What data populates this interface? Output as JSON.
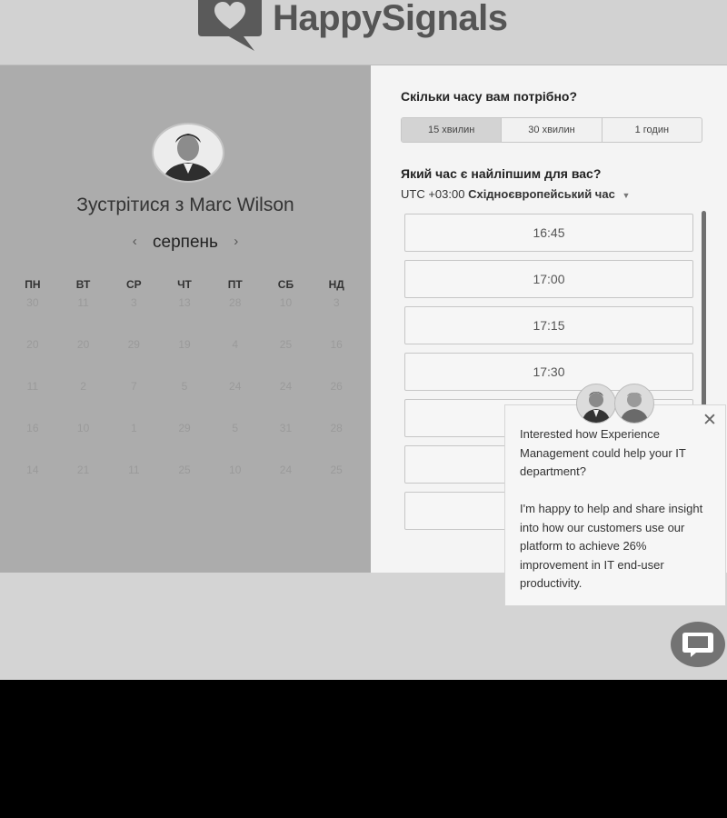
{
  "brand": {
    "name": "HappySignals",
    "logo_icon": "heart-speech-bubble-icon"
  },
  "left_panel": {
    "meet_title": "Зустрітися з Marc Wilson",
    "month": "серпень",
    "prev_icon": "chevron-left-icon",
    "next_icon": "chevron-right-icon",
    "weekdays": [
      "ПН",
      "ВТ",
      "СР",
      "ЧТ",
      "ПТ",
      "СБ",
      "НД"
    ],
    "weeks": [
      [
        "30",
        "11",
        "3",
        "13",
        "28",
        "10",
        "3"
      ],
      [
        "20",
        "20",
        "29",
        "19",
        "4",
        "25",
        "16"
      ],
      [
        "11",
        "2",
        "7",
        "5",
        "24",
        "24",
        "26"
      ],
      [
        "16",
        "10",
        "1",
        "29",
        "5",
        "31",
        "28"
      ],
      [
        "14",
        "21",
        "11",
        "25",
        "10",
        "24",
        "25"
      ]
    ]
  },
  "right_panel": {
    "duration_question": "Скільки часу вам потрібно?",
    "durations": [
      "15 хвилин",
      "30 хвилин",
      "1 годин"
    ],
    "selected_duration": "15 хвилин",
    "time_question": "Який час є найліпшим для вас?",
    "timezone_offset": "UTC +03:00",
    "timezone_name": "Східноєвропейський час",
    "time_slots": [
      "16:45",
      "17:00",
      "17:15",
      "17:30",
      "",
      "",
      "",
      ""
    ]
  },
  "popup": {
    "message_1": "Interested how Experience Management could help your IT department?",
    "message_2": "I'm happy to help and share insight into how our customers use our platform to achieve 26% improvement in IT end-user productivity.",
    "close_icon": "close-icon"
  },
  "chat_button": {
    "icon": "chat-bubble-icon"
  }
}
